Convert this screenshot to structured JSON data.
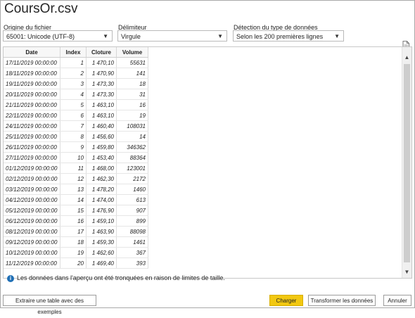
{
  "window": {
    "title": "CoursOr.csv"
  },
  "controls": {
    "origin": {
      "label": "Origine du fichier",
      "value": "65001: Unicode (UTF-8)"
    },
    "delimiter": {
      "label": "Délimiteur",
      "value": "Virgule"
    },
    "detection": {
      "label": "Détection du type de données",
      "value": "Selon les 200 premières lignes"
    }
  },
  "table": {
    "headers": [
      "Date",
      "Index",
      "Cloture",
      "Volume"
    ],
    "rows": [
      [
        "17/11/2019 00:00:00",
        "1",
        "1 470,10",
        "55631"
      ],
      [
        "18/11/2019 00:00:00",
        "2",
        "1 470,90",
        "141"
      ],
      [
        "19/11/2019 00:00:00",
        "3",
        "1 473,30",
        "18"
      ],
      [
        "20/11/2019 00:00:00",
        "4",
        "1 473,30",
        "31"
      ],
      [
        "21/11/2019 00:00:00",
        "5",
        "1 463,10",
        "16"
      ],
      [
        "22/11/2019 00:00:00",
        "6",
        "1 463,10",
        "19"
      ],
      [
        "24/11/2019 00:00:00",
        "7",
        "1 460,40",
        "108031"
      ],
      [
        "25/11/2019 00:00:00",
        "8",
        "1 456,60",
        "14"
      ],
      [
        "26/11/2019 00:00:00",
        "9",
        "1 459,80",
        "346362"
      ],
      [
        "27/11/2019 00:00:00",
        "10",
        "1 453,40",
        "88364"
      ],
      [
        "01/12/2019 00:00:00",
        "11",
        "1 468,00",
        "123001"
      ],
      [
        "02/12/2019 00:00:00",
        "12",
        "1 462,30",
        "2172"
      ],
      [
        "03/12/2019 00:00:00",
        "13",
        "1 478,20",
        "1460"
      ],
      [
        "04/12/2019 00:00:00",
        "14",
        "1 474,00",
        "613"
      ],
      [
        "05/12/2019 00:00:00",
        "15",
        "1 476,90",
        "907"
      ],
      [
        "06/12/2019 00:00:00",
        "16",
        "1 459,10",
        "899"
      ],
      [
        "08/12/2019 00:00:00",
        "17",
        "1 463,90",
        "88098"
      ],
      [
        "09/12/2019 00:00:00",
        "18",
        "1 459,30",
        "1461"
      ],
      [
        "10/12/2019 00:00:00",
        "19",
        "1 462,60",
        "367"
      ],
      [
        "11/12/2019 00:00:00",
        "20",
        "1 469,40",
        "393"
      ]
    ]
  },
  "info": {
    "icon": "info-icon",
    "text": "Les données dans l'aperçu ont été tronquées en raison de limites de taille."
  },
  "buttons": {
    "extract": "Extraire une table avec des exemples",
    "load": "Charger",
    "transform": "Transformer les données",
    "cancel": "Annuler"
  },
  "colors": {
    "primary_button": "#f2c811",
    "info_icon": "#1f6fb5"
  }
}
